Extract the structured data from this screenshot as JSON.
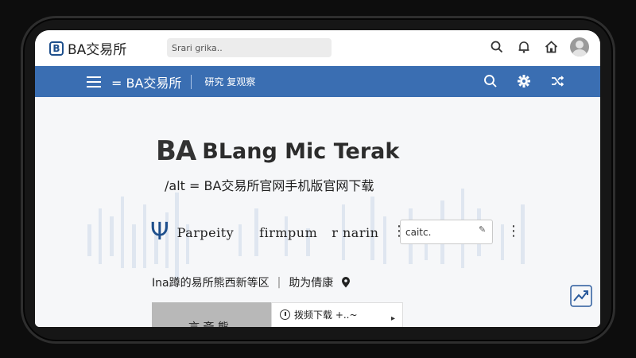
{
  "topbar": {
    "logo_letter": "B",
    "logo_text": "BA交易所",
    "search_value": "Srari grika.."
  },
  "icons": {
    "search": "search-icon",
    "bell": "bell-icon",
    "home": "home-icon",
    "avatar": "avatar",
    "menu": "hamburger-icon",
    "settings": "gear-icon",
    "shuffle": "shuffle-icon",
    "location": "location-pin-icon",
    "clock": "clock-icon",
    "chart": "trending-chart-icon"
  },
  "navbar": {
    "brand": "= BA交易所",
    "link": "研究 复观察"
  },
  "hero": {
    "logo": "BA",
    "name": "BLang Mic Terak",
    "subtitle": "/alt = BA交易所官网手机版官网下载"
  },
  "tabs": {
    "tab1": "Parpeity",
    "tab2": "firmpum",
    "tab3": "r narin",
    "input_value": "caitc."
  },
  "info": {
    "left": "Ina蹲的易所熊西新等区",
    "sep": "|",
    "right": "助为倩康"
  },
  "cards": {
    "grey_label": "言 斋 熊",
    "white_label": "拨频下载 +..~",
    "white_arrow": "▸"
  },
  "colors": {
    "nav": "#3a6eb2",
    "brand": "#1e4f8c",
    "background": "#f6f7f9"
  }
}
